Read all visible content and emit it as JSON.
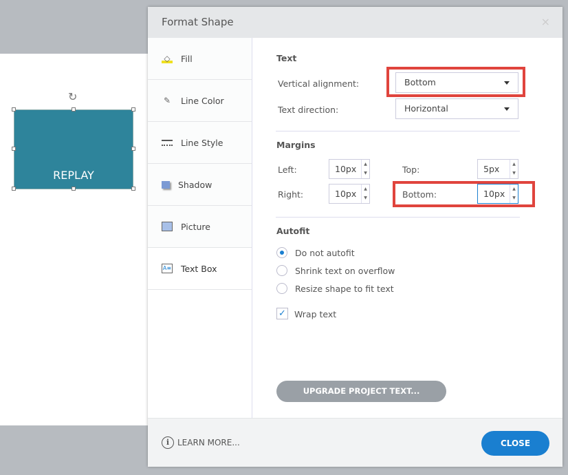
{
  "canvas": {
    "shape_text": "REPLAY"
  },
  "dialog": {
    "title": "Format Shape",
    "close_x": "×",
    "sidebar": [
      {
        "label": "Fill"
      },
      {
        "label": "Line Color"
      },
      {
        "label": "Line Style"
      },
      {
        "label": "Shadow"
      },
      {
        "label": "Picture"
      },
      {
        "label": "Text Box"
      }
    ],
    "text": {
      "heading": "Text",
      "vertical_alignment_label": "Vertical alignment:",
      "vertical_alignment_value": "Bottom",
      "text_direction_label": "Text direction:",
      "text_direction_value": "Horizontal"
    },
    "margins": {
      "heading": "Margins",
      "left_label": "Left:",
      "left_value": "10px",
      "right_label": "Right:",
      "right_value": "10px",
      "top_label": "Top:",
      "top_value": "5px",
      "bottom_label": "Bottom:",
      "bottom_value": "10px"
    },
    "autofit": {
      "heading": "Autofit",
      "options": [
        "Do not autofit",
        "Shrink text on overflow",
        "Resize shape to fit text"
      ],
      "selected": 0,
      "wrap_label": "Wrap text",
      "wrap_checked": true
    },
    "upgrade_label": "UPGRADE PROJECT TEXT...",
    "learn_more": "LEARN MORE...",
    "close_label": "CLOSE"
  }
}
